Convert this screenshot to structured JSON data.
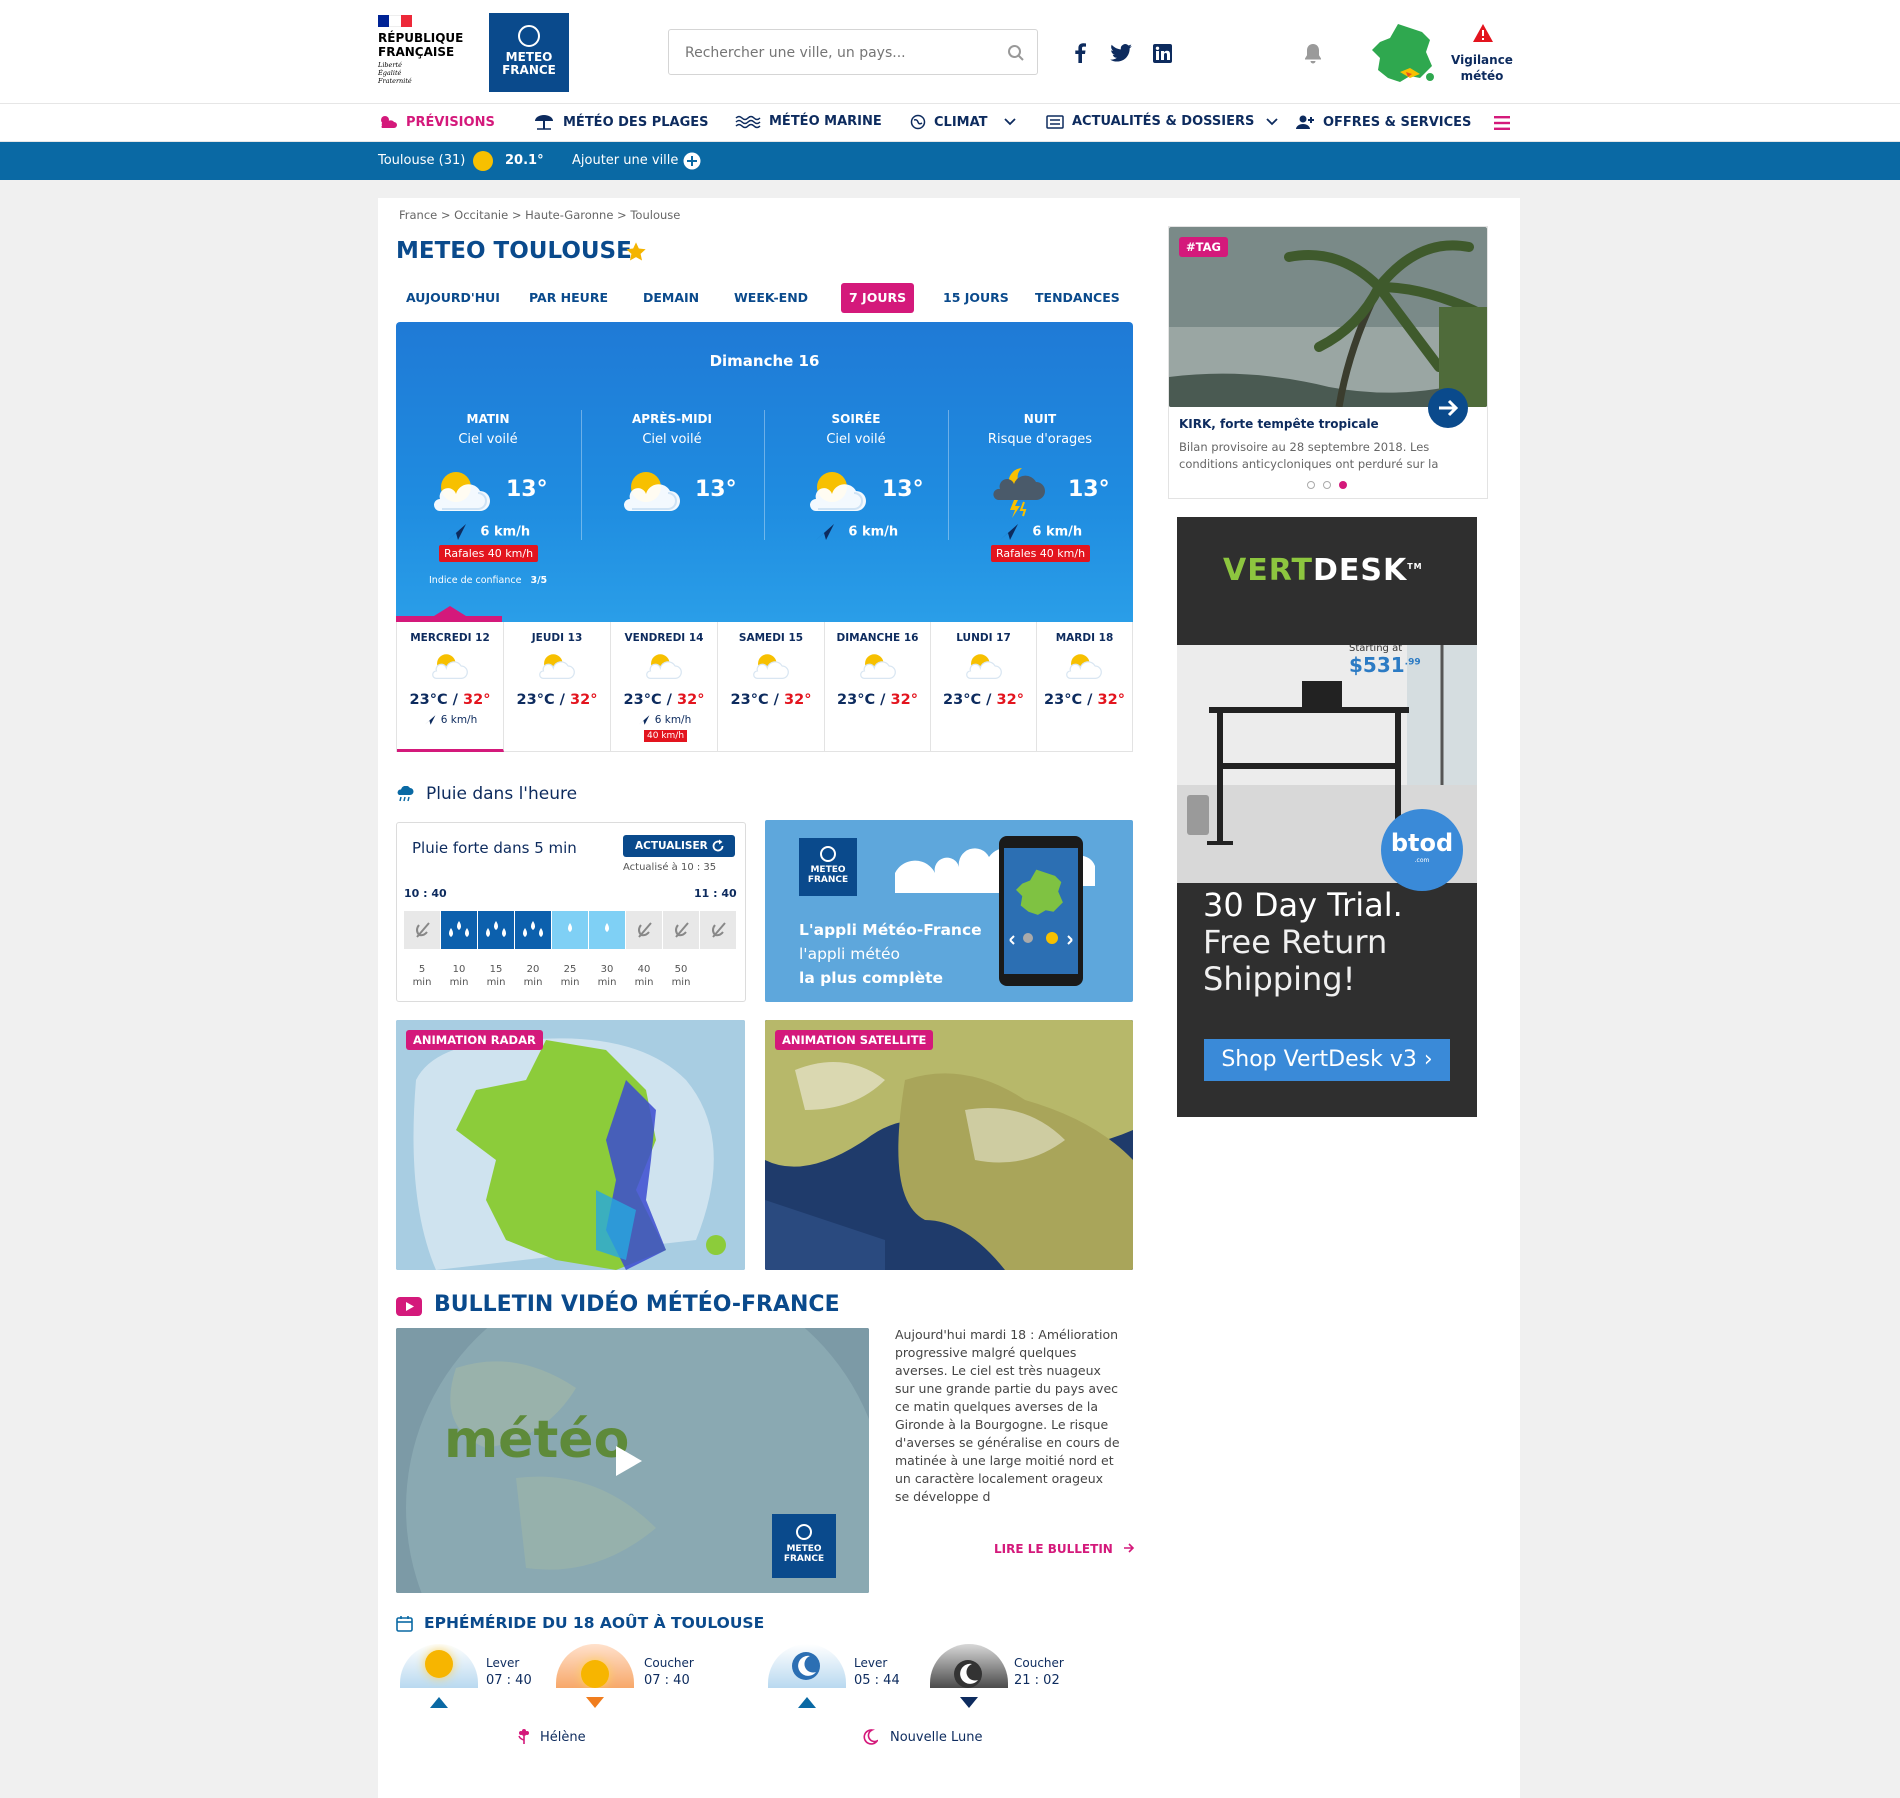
{
  "header": {
    "republique_line1": "RÉPUBLIQUE",
    "republique_line2": "FRANÇAISE",
    "motto": [
      "Liberté",
      "Égalité",
      "Fraternité"
    ],
    "logo_line1": "METEO",
    "logo_line2": "FRANCE",
    "search_placeholder": "Rechercher une ville, un pays...",
    "vigilance_line1": "Vigilance",
    "vigilance_line2": "météo"
  },
  "nav": {
    "previsions": "PRÉVISIONS",
    "plages": "MÉTÉO DES PLAGES",
    "marine": "MÉTÉO MARINE",
    "climat": "CLIMAT",
    "actualites": "ACTUALITÉS & DOSSIERS",
    "offres": "OFFRES & SERVICES"
  },
  "citybar": {
    "city": "Toulouse (31)",
    "temp": "20.1°",
    "add_city": "Ajouter une ville"
  },
  "breadcrumb": "France > Occitanie > Haute-Garonne > Toulouse",
  "page_title": "METEO TOULOUSE",
  "tabs": [
    "AUJOURD'HUI",
    "PAR HEURE",
    "DEMAIN",
    "WEEK-END",
    "7 JOURS",
    "15 JOURS",
    "TENDANCES"
  ],
  "active_tab": "7 JOURS",
  "forecast": {
    "day_title": "Dimanche 16",
    "periods": [
      {
        "name": "MATIN",
        "desc": "Ciel voilé",
        "temp": "13°",
        "wind": "6 km/h",
        "rafales": "Rafales 40 km/h",
        "icon": "cloud-sun-icon"
      },
      {
        "name": "APRÈS-MIDI",
        "desc": "Ciel voilé",
        "temp": "13°",
        "wind": "",
        "rafales": "",
        "icon": "cloud-sun-icon"
      },
      {
        "name": "SOIRÉE",
        "desc": "Ciel voilé",
        "temp": "13°",
        "wind": "6 km/h",
        "rafales": "",
        "icon": "cloud-sun-icon"
      },
      {
        "name": "NUIT",
        "desc": "Risque d'orages",
        "temp": "13°",
        "wind": "6 km/h",
        "rafales": "Rafales 40 km/h",
        "icon": "storm-moon-icon"
      }
    ],
    "confidence_label": "Indice de confiance",
    "confidence_value": "3/5"
  },
  "days": [
    {
      "name": "MERCREDI 12",
      "min": "23°C",
      "max": "32°",
      "wind": "6 km/h",
      "rafales": ""
    },
    {
      "name": "JEUDI 13",
      "min": "23°C",
      "max": "32°",
      "wind": "",
      "rafales": ""
    },
    {
      "name": "VENDREDI 14",
      "min": "23°C",
      "max": "32°",
      "wind": "6 km/h",
      "rafales": "40 km/h"
    },
    {
      "name": "SAMEDI 15",
      "min": "23°C",
      "max": "32°",
      "wind": "",
      "rafales": ""
    },
    {
      "name": "DIMANCHE 16",
      "min": "23°C",
      "max": "32°",
      "wind": "",
      "rafales": ""
    },
    {
      "name": "LUNDI 17",
      "min": "23°C",
      "max": "32°",
      "wind": "",
      "rafales": ""
    },
    {
      "name": "MARDI 18",
      "min": "23°C",
      "max": "32°",
      "wind": "",
      "rafales": ""
    }
  ],
  "rain": {
    "title": "Pluie dans l'heure",
    "status": "Pluie forte dans 5 min",
    "refresh_label": "ACTUALISER",
    "updated": "Actualisé à 10 : 35",
    "start": "10 : 40",
    "end": "11 : 40",
    "slots": [
      {
        "level": 0,
        "min": "5",
        "unit": "min"
      },
      {
        "level": 3,
        "min": "10",
        "unit": "min"
      },
      {
        "level": 3,
        "min": "15",
        "unit": "min"
      },
      {
        "level": 3,
        "min": "20",
        "unit": "min"
      },
      {
        "level": 1,
        "min": "25",
        "unit": "min"
      },
      {
        "level": 1,
        "min": "30",
        "unit": "min"
      },
      {
        "level": 0,
        "min": "40",
        "unit": "min"
      },
      {
        "level": 0,
        "min": "50",
        "unit": "min"
      },
      {
        "level": 0,
        "min": "",
        "unit": ""
      }
    ],
    "colors": {
      "none": "#e8e8e8",
      "low": "#7fd0f5",
      "mid": "#2aa3df",
      "high": "#0c60ad"
    }
  },
  "app_promo": {
    "logo_line1": "METEO",
    "logo_line2": "FRANCE",
    "line1": "L'appli Météo-France",
    "line2": "l'appli météo",
    "line3": "la plus complète"
  },
  "radar_tag": "ANIMATION RADAR",
  "satellite_tag": "ANIMATION SATELLITE",
  "video": {
    "title": "BULLETIN VIDÉO MÉTÉO-FRANCE",
    "overlay_word": "météo",
    "logo_line1": "METEO",
    "logo_line2": "FRANCE",
    "text": "Aujourd'hui mardi 18 : Amélioration progressive malgré quelques averses. Le ciel est très nuageux sur une grande partie du pays avec ce matin quelques averses de la Gironde à la Bourgogne. Le risque d'averses se généralise en cours de matinée à une large moitié nord et un caractère localement orageux se développe d",
    "link": "LIRE LE BULLETIN"
  },
  "ephemeride": {
    "title": "EPHÉMÉRIDE DU 18 AOÛT À TOULOUSE",
    "sun_rise_label": "Lever",
    "sun_rise": "07 : 40",
    "sun_set_label": "Coucher",
    "sun_set": "07 : 40",
    "moon_rise_label": "Lever",
    "moon_rise": "05 : 44",
    "moon_set_label": "Coucher",
    "moon_set": "21 : 02",
    "saint": "Hélène",
    "moon_phase": "Nouvelle Lune"
  },
  "news": {
    "tag": "#TAG",
    "title": "KIRK, forte tempête tropicale",
    "excerpt": "Bilan provisoire au 28 septembre 2018. Les conditions anticycloniques ont perduré sur la"
  },
  "ad": {
    "brand_a": "VERT",
    "brand_b": "DESK",
    "tm": "TM",
    "starting": "Starting at",
    "price": "$531",
    "cents": ".99",
    "btod": "btod",
    "btod_sub": ".com",
    "line1": "30 Day Trial.",
    "line2": "Free Return",
    "line3": "Shipping!",
    "cta": "Shop VertDesk v3 ›"
  }
}
